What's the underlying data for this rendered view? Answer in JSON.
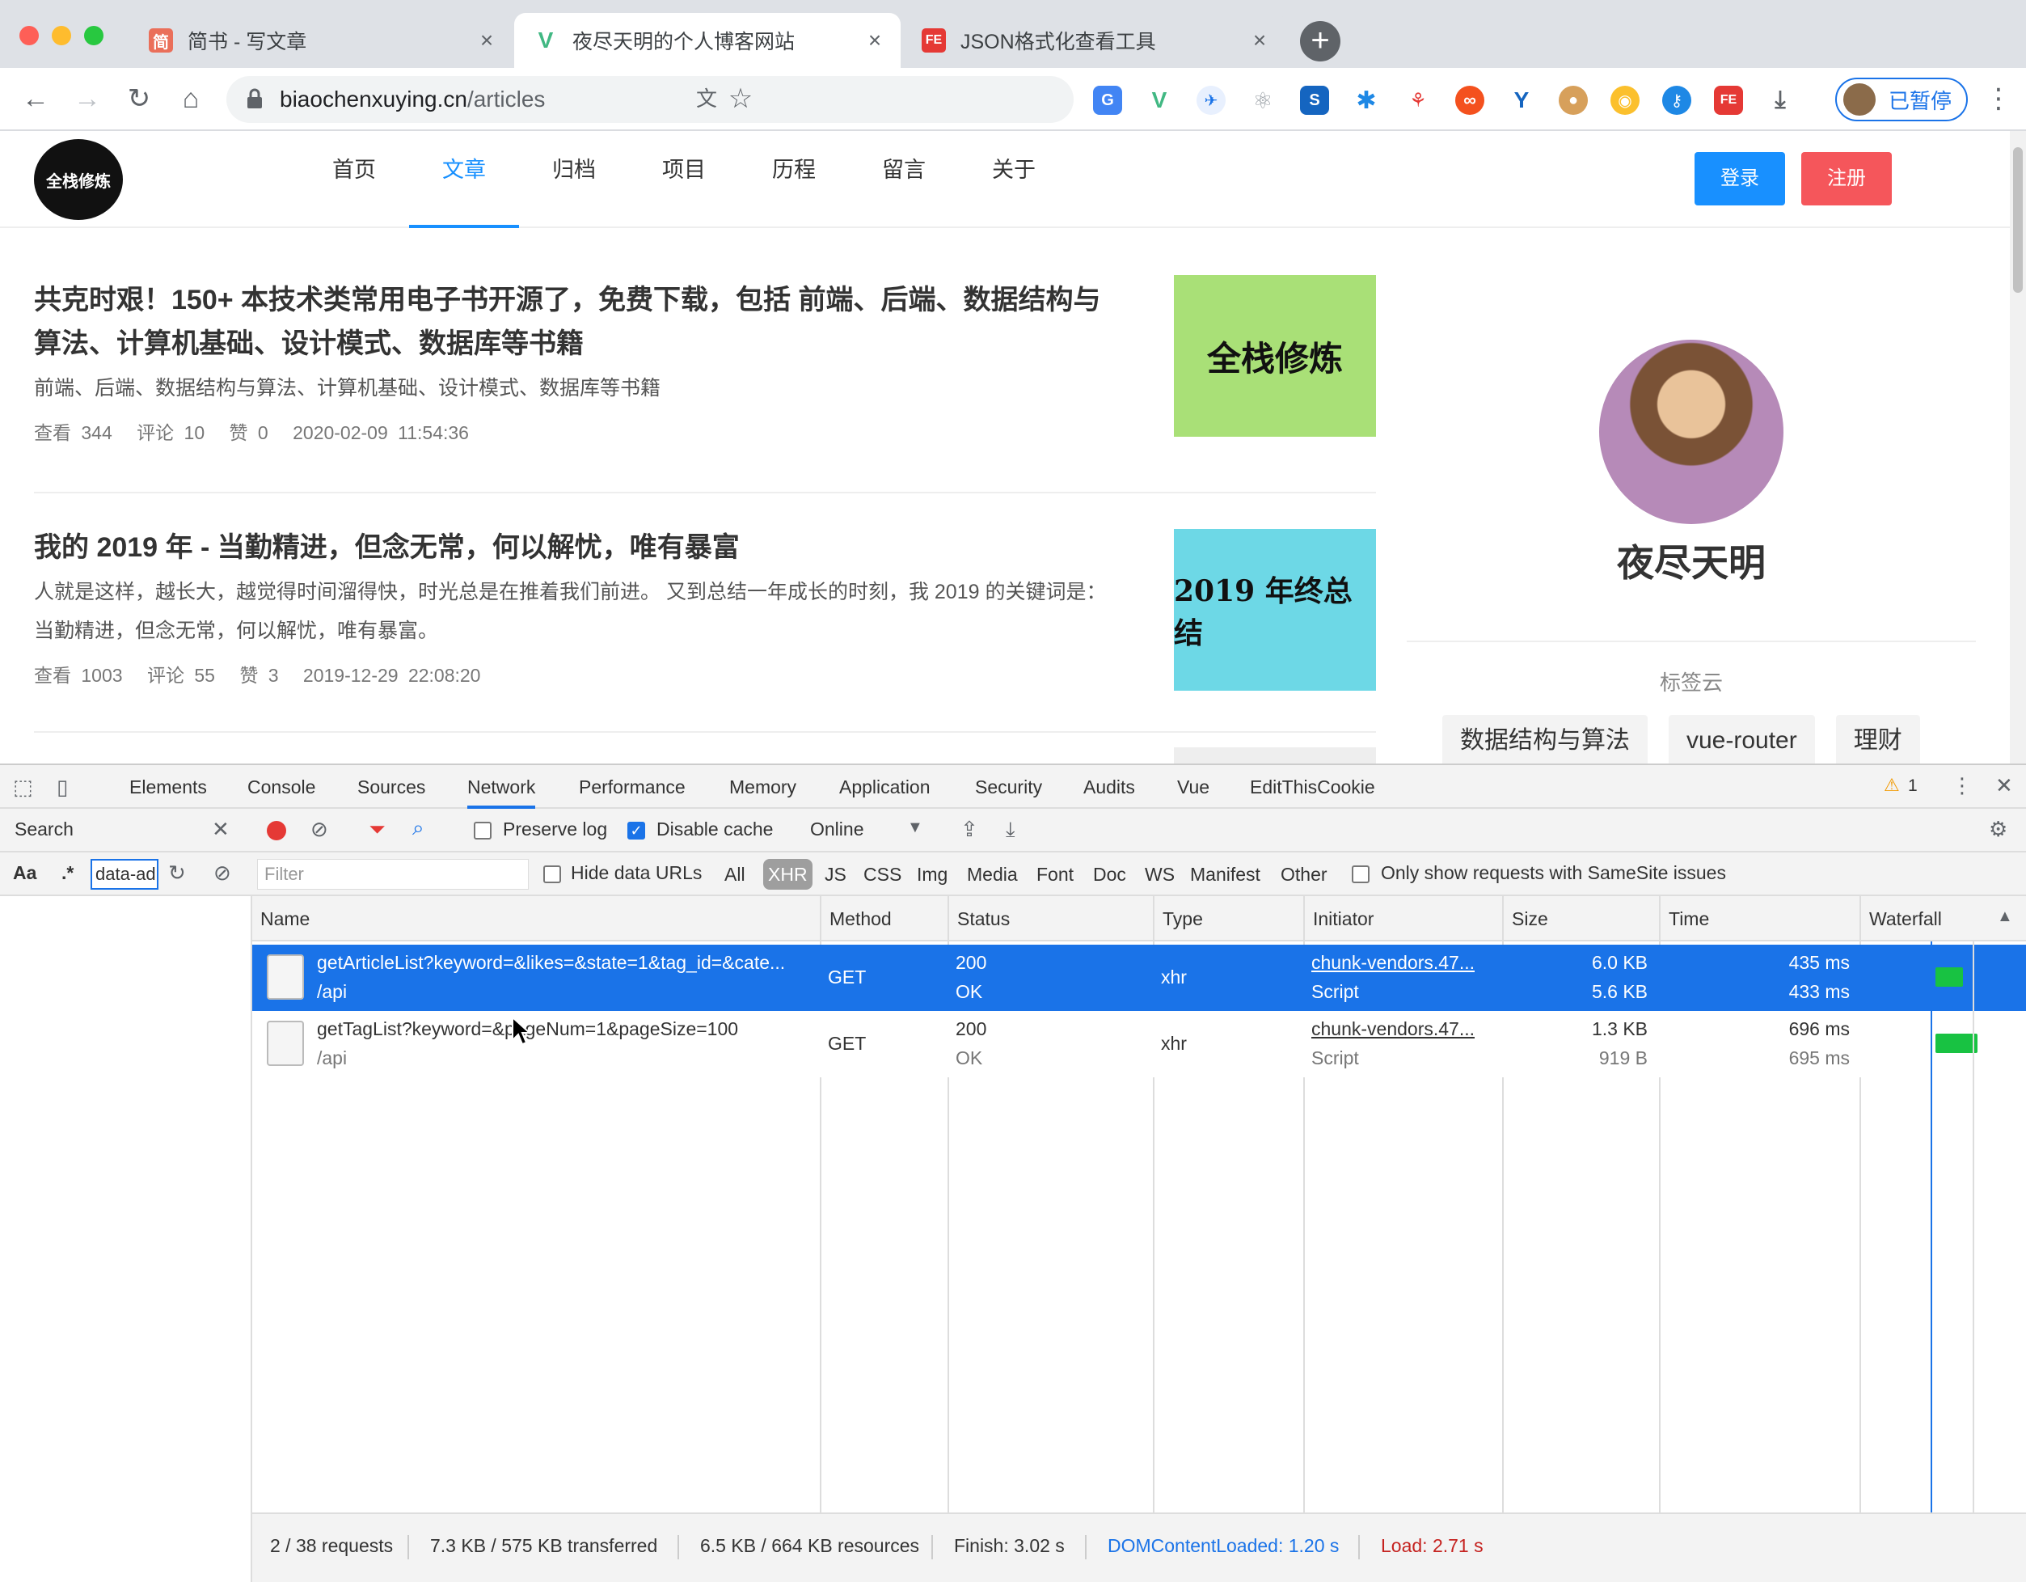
{
  "browser": {
    "tabs": [
      {
        "icon_text": "简",
        "title": "简书 - 写文章",
        "active": false
      },
      {
        "icon_text": "V",
        "title": "夜尽天明的个人博客网站",
        "active": true
      },
      {
        "icon_text": "FE",
        "title": "JSON格式化查看工具",
        "active": false
      }
    ],
    "url_host": "biaochenxuying.cn",
    "url_path": "/articles",
    "profile_label": "已暂停"
  },
  "site": {
    "logo_text": "全栈修炼",
    "nav": [
      "首页",
      "文章",
      "归档",
      "项目",
      "历程",
      "留言",
      "关于"
    ],
    "active_nav": "文章",
    "login_label": "登录",
    "register_label": "注册",
    "articles": [
      {
        "title": "共克时艰！150+ 本技术类常用电子书开源了，免费下载，包括 前端、后端、数据结构与算法、计算机基础、设计模式、数据库等书籍",
        "desc": "前端、后端、数据结构与算法、计算机基础、设计模式、数据库等书籍",
        "views": "查看 344",
        "comments": "评论 10",
        "likes": "赞 0",
        "date": "2020-02-09 11:54:36",
        "image_text": "全栈修炼",
        "image_color": "#a9e077"
      },
      {
        "title": "我的 2019 年 - 当勤精进，但念无常，何以解忧，唯有暴富",
        "desc": "人就是这样，越长大，越觉得时间溜得快，时光总是在推着我们前进。 又到总结一年成长的时刻，我 2019 的关键词是：当勤精进，但念无常，何以解忧，唯有暴富。",
        "views": "查看 1003",
        "comments": "评论 55",
        "likes": "赞 3",
        "date": "2019-12-29 22:08:20",
        "image_text": "2019 年终总结",
        "image_color": "#6dd8e6"
      }
    ],
    "author": "夜尽天明",
    "tagcloud_title": "标签云",
    "tags": [
      "数据结构与算法",
      "vue-router",
      "理财"
    ]
  },
  "devtools": {
    "tabs": [
      "Elements",
      "Console",
      "Sources",
      "Network",
      "Performance",
      "Memory",
      "Application",
      "Security",
      "Audits",
      "Vue",
      "EditThisCookie"
    ],
    "active_tab": "Network",
    "warning_count": "1",
    "search": {
      "title": "Search",
      "case_label": "Aa",
      "regex_label": ".*",
      "query": "data-ad"
    },
    "toolbar": {
      "preserve_log": "Preserve log",
      "disable_cache": "Disable cache",
      "throttle": "Online"
    },
    "filter": {
      "placeholder": "Filter",
      "hide_data_urls": "Hide data URLs",
      "types": [
        "All",
        "XHR",
        "JS",
        "CSS",
        "Img",
        "Media",
        "Font",
        "Doc",
        "WS",
        "Manifest",
        "Other"
      ],
      "active_type": "XHR",
      "samesite": "Only show requests with SameSite issues"
    },
    "columns": [
      "Name",
      "Method",
      "Status",
      "Type",
      "Initiator",
      "Size",
      "Time",
      "Waterfall"
    ],
    "requests": [
      {
        "name": "getArticleList?keyword=&likes=&state=1&tag_id=&cate...",
        "path": "/api",
        "method": "GET",
        "status": "200",
        "status_text": "OK",
        "type": "xhr",
        "initiator": "chunk-vendors.47...",
        "initiator_type": "Script",
        "size": "6.0 KB",
        "resource_size": "5.6 KB",
        "time": "435 ms",
        "latency": "433 ms",
        "selected": true
      },
      {
        "name": "getTagList?keyword=&pageNum=1&pageSize=100",
        "path": "/api",
        "method": "GET",
        "status": "200",
        "status_text": "OK",
        "type": "xhr",
        "initiator": "chunk-vendors.47...",
        "initiator_type": "Script",
        "size": "1.3 KB",
        "resource_size": "919 B",
        "time": "696 ms",
        "latency": "695 ms",
        "selected": false
      }
    ],
    "status_bar": {
      "requests": "2 / 38 requests",
      "transferred": "7.3 KB / 575 KB transferred",
      "resources": "6.5 KB / 664 KB resources",
      "finish": "Finish: 3.02 s",
      "dom_loaded": "DOMContentLoaded: 1.20 s",
      "load": "Load: 2.71 s"
    }
  }
}
